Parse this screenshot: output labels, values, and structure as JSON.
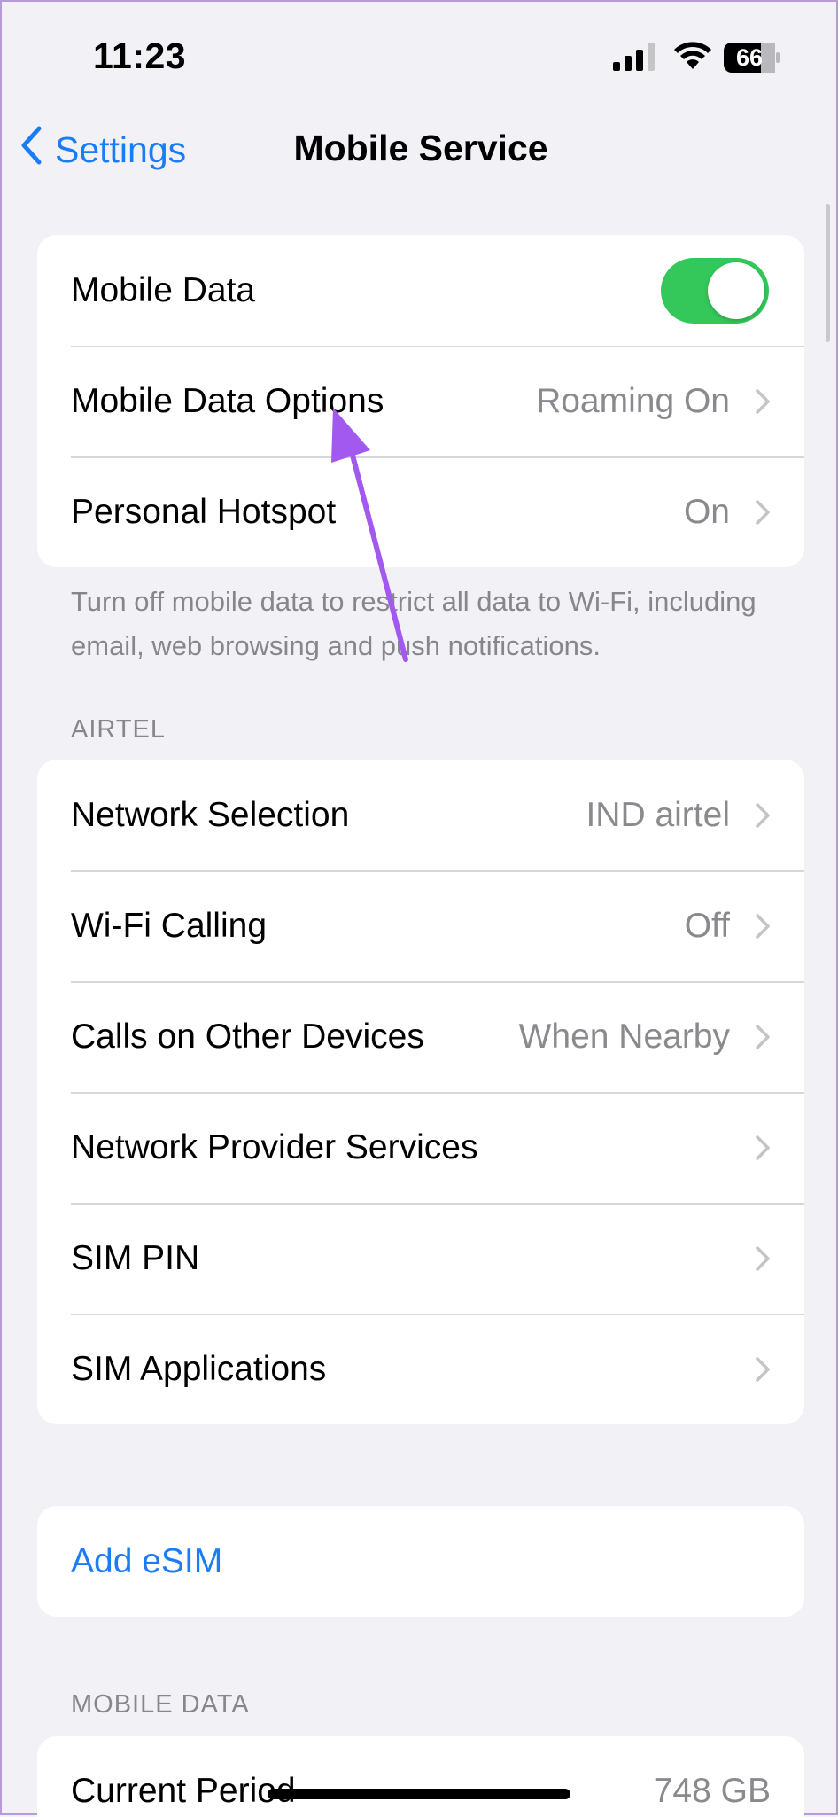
{
  "status_bar": {
    "time": "11:23",
    "battery": "66",
    "icons": [
      "cellular-signal-icon",
      "wifi-icon",
      "battery-icon"
    ]
  },
  "nav": {
    "back_label": "Settings",
    "title": "Mobile Service"
  },
  "group1": {
    "rows": [
      {
        "label": "Mobile Data",
        "toggle_on": true
      },
      {
        "label": "Mobile Data Options",
        "value": "Roaming On"
      },
      {
        "label": "Personal Hotspot",
        "value": "On"
      }
    ],
    "footnote": "Turn off mobile data to restrict all data to Wi-Fi, including email, web browsing and push notifications."
  },
  "carrier_section": {
    "header": "AIRTEL",
    "rows": [
      {
        "label": "Network Selection",
        "value": "IND airtel"
      },
      {
        "label": "Wi-Fi Calling",
        "value": "Off"
      },
      {
        "label": "Calls on Other Devices",
        "value": "When Nearby"
      },
      {
        "label": "Network Provider Services",
        "value": ""
      },
      {
        "label": "SIM PIN",
        "value": ""
      },
      {
        "label": "SIM Applications",
        "value": ""
      }
    ]
  },
  "esim": {
    "label": "Add eSIM"
  },
  "mobile_data_section": {
    "header": "MOBILE DATA",
    "rows": [
      {
        "label": "Current Period",
        "value": "748 GB"
      }
    ]
  },
  "colors": {
    "accent": "#1a7cf6",
    "toggle_on": "#34c759",
    "annotation_arrow": "#a259f0",
    "background": "#f2f1f6"
  }
}
